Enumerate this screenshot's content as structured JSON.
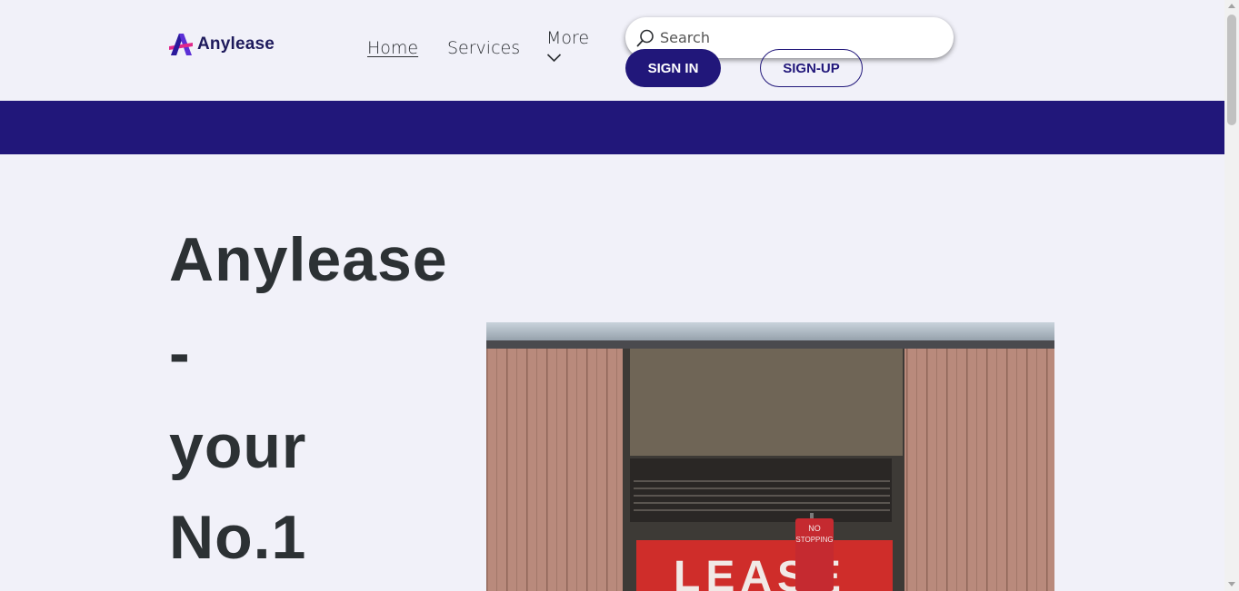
{
  "header": {
    "brand": "Anylease",
    "nav": {
      "home": "Home",
      "services": "Services",
      "more": "More"
    },
    "search": {
      "placeholder": "Search",
      "value": ""
    },
    "sign_in_label": "SIGN IN",
    "sign_up_label": "SIGN-UP"
  },
  "hero": {
    "title_lines": [
      "Anylease",
      "-",
      "your",
      "No.1"
    ],
    "image": {
      "sign_text": "LEASE",
      "post_sign_line1": "NO",
      "post_sign_line2": "STOPPING"
    }
  },
  "colors": {
    "brand_primary": "#21177a",
    "background": "#f1f1f9",
    "heading": "#2c3134"
  },
  "icons": {
    "search": "search-icon",
    "more": "chevron-down-icon",
    "logo": "anylease-logo-icon"
  }
}
